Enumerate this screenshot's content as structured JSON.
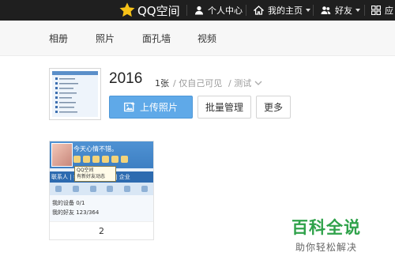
{
  "topbar": {
    "logo_text": "QQ空间",
    "profile_label": "个人中心",
    "home_label": "我的主页",
    "friends_label": "好友",
    "apps_label": "应"
  },
  "subnav": {
    "items": [
      "相册",
      "照片",
      "面孔墙",
      "视频"
    ]
  },
  "album": {
    "title": "2016",
    "count_num": "1",
    "count_unit": "张",
    "visibility": "/ 仅自己可见",
    "category": "/ 测试",
    "upload_label": "上传照片",
    "batch_label": "批量管理",
    "more_label": "更多"
  },
  "photos": [
    {
      "caption": "2",
      "inner": {
        "mood": "今天心情不错。",
        "tooltip_title": "QQ空间",
        "tooltip_body": "有新好友动态",
        "band_text": "联系人 | 会话 | 群/讨论组 | 企业",
        "device_line": "我的设备 0/1",
        "friend_line": "我的好友 123/364"
      }
    }
  ],
  "watermark": {
    "title": "百科全说",
    "subtitle": "助你轻松解决"
  },
  "colors": {
    "topbar": "#1f1f1f",
    "accent": "#5fa9e8",
    "watermark": "#2fa24a"
  }
}
